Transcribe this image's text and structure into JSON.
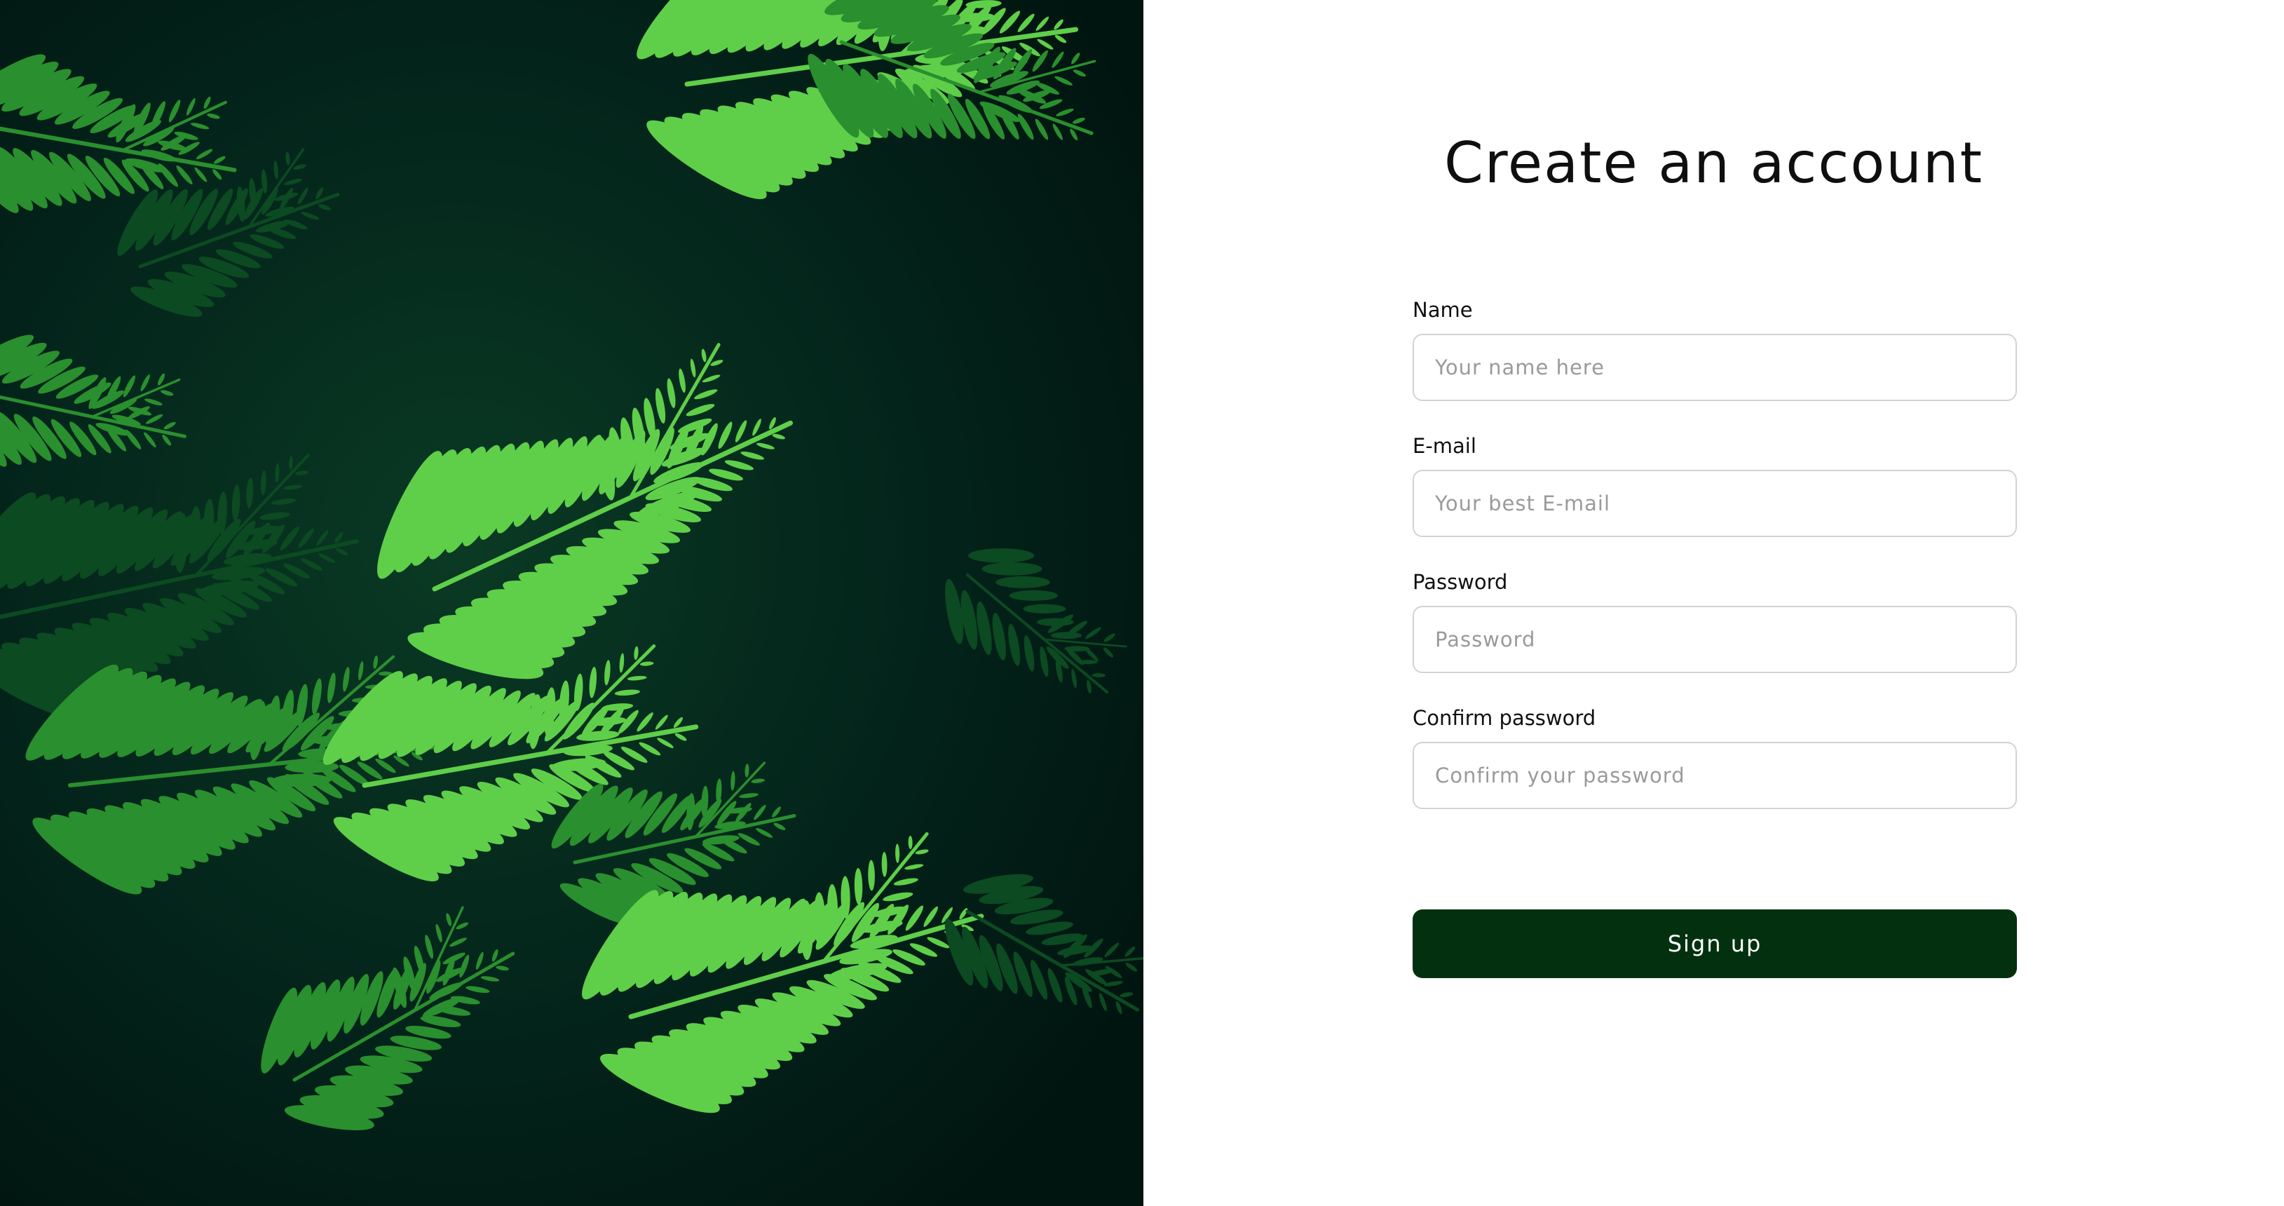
{
  "title": "Create an account",
  "form": {
    "fields": [
      {
        "label": "Name",
        "placeholder": "Your name here",
        "value": ""
      },
      {
        "label": "E-mail",
        "placeholder": "Your best E-mail",
        "value": ""
      },
      {
        "label": "Password",
        "placeholder": "Password",
        "value": ""
      },
      {
        "label": "Confirm password",
        "placeholder": "Confirm your password",
        "value": ""
      }
    ],
    "submit_label": "Sign up"
  },
  "hero": {
    "subject": "evergreen-fern-branches",
    "colors": {
      "dark": "#021b14",
      "mid": "#0c4a22",
      "leaf": "#2a8f2e",
      "highlight": "#5fcf4a"
    }
  },
  "colors": {
    "button_bg": "#03310f",
    "button_text": "#ffffff",
    "input_border": "#d3d3d3",
    "placeholder": "#9a9a9a"
  }
}
